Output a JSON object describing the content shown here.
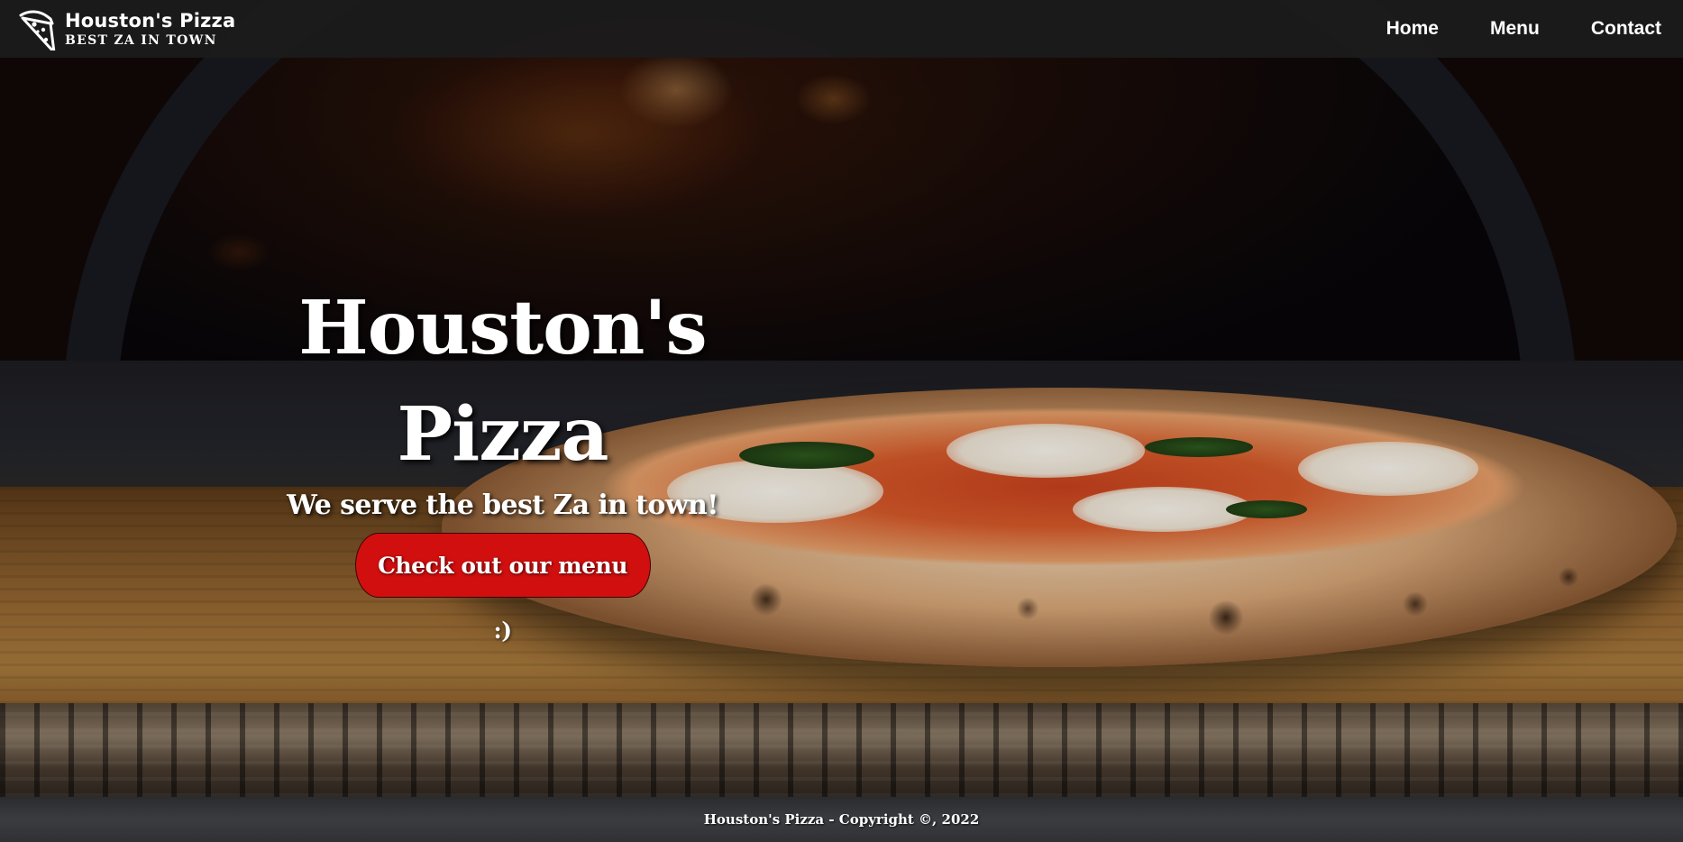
{
  "brand": {
    "name": "Houston's Pizza",
    "tagline": "BEST ZA IN TOWN",
    "logo_icon": "pizza-slice-icon"
  },
  "nav": {
    "items": [
      {
        "label": "Home"
      },
      {
        "label": "Menu"
      },
      {
        "label": "Contact"
      }
    ]
  },
  "hero": {
    "title_line1": "Houston's",
    "title_line2": "Pizza",
    "subtitle": "We serve the best Za in town!",
    "cta_label": "Check out our menu :)",
    "cta_color": "#d10f0f"
  },
  "footer": {
    "text": "Houston's Pizza - Copyright ©, 2022"
  }
}
